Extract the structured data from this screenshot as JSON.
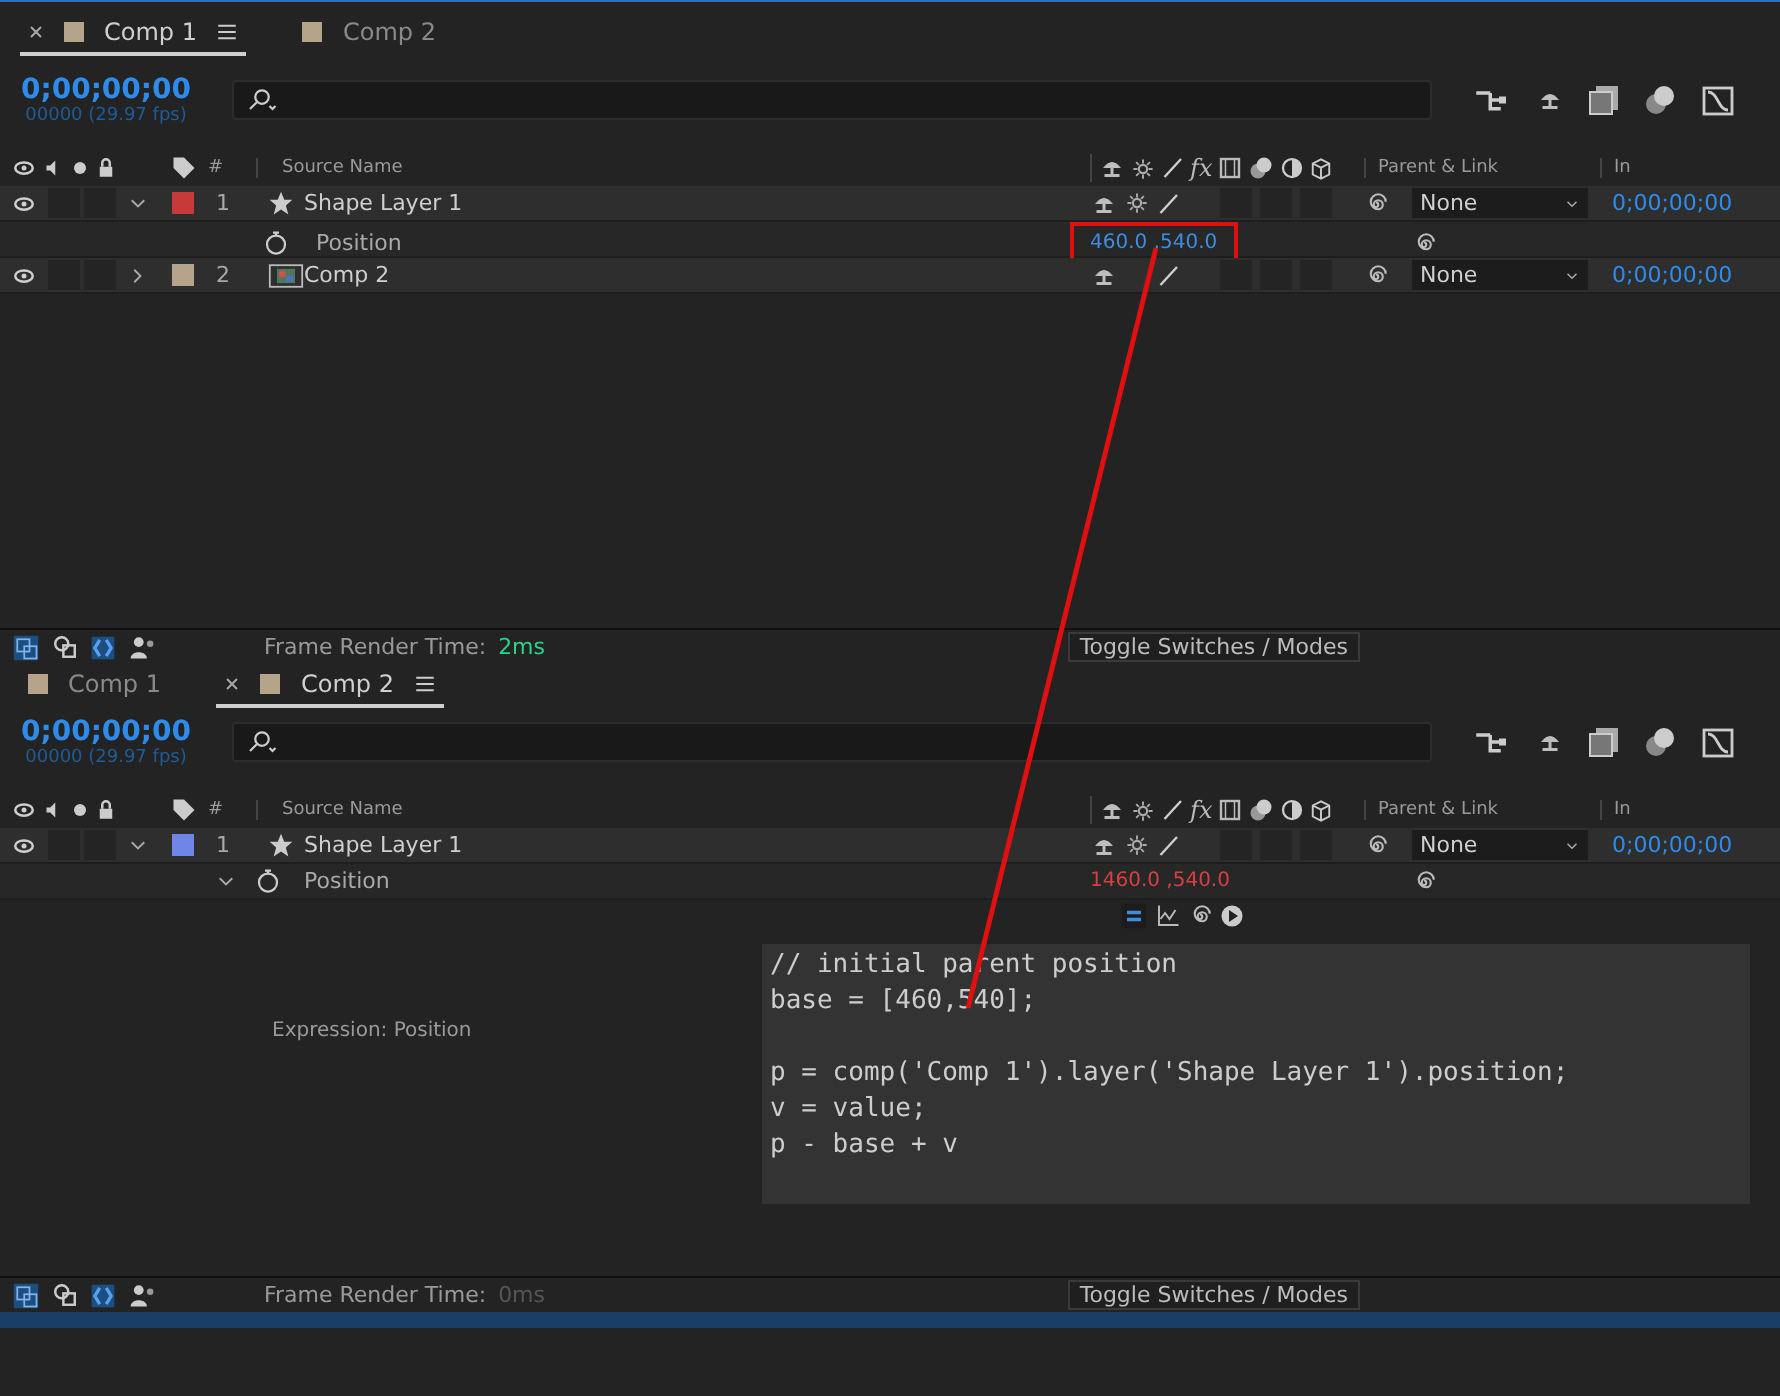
{
  "panels": [
    {
      "tabs": [
        {
          "label": "Comp 1",
          "selected": true
        },
        {
          "label": "Comp 2",
          "selected": false
        }
      ],
      "timecode": "0;00;00;00",
      "frames": "00000 (29.97 fps)",
      "columns": {
        "index": "#",
        "source": "Source Name",
        "fx": "fx",
        "parent": "Parent & Link",
        "in": "In"
      },
      "layers": [
        {
          "index": "1",
          "name": "Shape Layer 1",
          "kind": "shape",
          "color": "#c83a3a",
          "expanded": true,
          "parent": "None",
          "in": "0;00;00;00",
          "properties": [
            {
              "name": "Position",
              "value": "460.0 ,540.0",
              "expression": false,
              "expanded": false,
              "highlighted": true
            }
          ]
        },
        {
          "index": "2",
          "name": "Comp 2",
          "kind": "comp",
          "color": "#b5a48a",
          "expanded": false,
          "parent": "None",
          "in": "0;00;00;00"
        }
      ],
      "footer": {
        "label": "Frame Render Time:",
        "time": "2ms",
        "toggle": "Toggle Switches / Modes"
      }
    },
    {
      "tabs": [
        {
          "label": "Comp 1",
          "selected": false
        },
        {
          "label": "Comp 2",
          "selected": true
        }
      ],
      "timecode": "0;00;00;00",
      "frames": "00000 (29.97 fps)",
      "columns": {
        "index": "#",
        "source": "Source Name",
        "fx": "fx",
        "parent": "Parent & Link",
        "in": "In"
      },
      "layers": [
        {
          "index": "1",
          "name": "Shape Layer 1",
          "kind": "shape",
          "color": "#6f86e6",
          "expanded": true,
          "parent": "None",
          "in": "0;00;00;00",
          "properties": [
            {
              "name": "Position",
              "value": "1460.0 ,540.0",
              "expression": true,
              "expanded": true,
              "highlighted": false,
              "expression_label": "Expression: Position",
              "code": "// initial parent position\nbase = [460,540];\n\np = comp('Comp 1').layer('Shape Layer 1').position;\nv = value;\np - base + v"
            }
          ]
        }
      ],
      "footer": {
        "label": "Frame Render Time:",
        "time": "0ms",
        "toggle": "Toggle Switches / Modes"
      }
    }
  ]
}
